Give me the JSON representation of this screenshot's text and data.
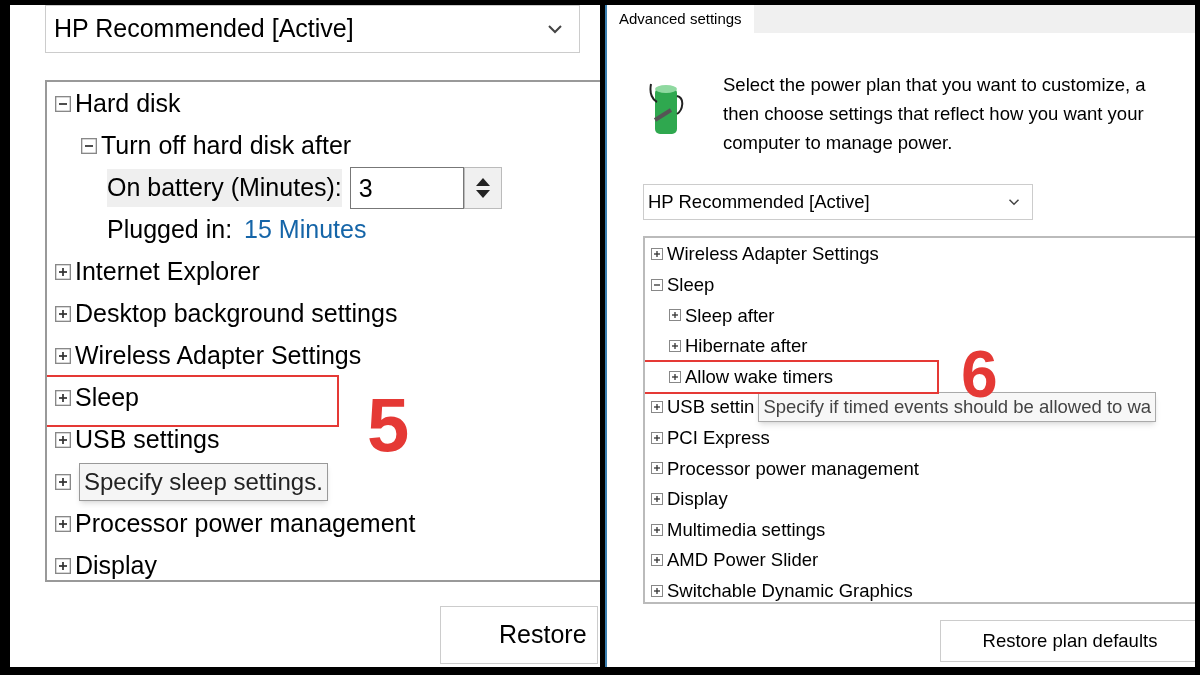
{
  "left_panel": {
    "plan_dropdown": {
      "value": "HP Recommended [Active]"
    },
    "tree": [
      {
        "kind": "group",
        "label": "Hard disk",
        "expanded": true,
        "children": [
          {
            "kind": "group",
            "label": "Turn off hard disk after",
            "expanded": true,
            "children": [
              {
                "kind": "spin",
                "label": "On battery (Minutes):",
                "value": "3"
              },
              {
                "kind": "value",
                "label": "Plugged in:",
                "value": "15 Minutes"
              }
            ]
          }
        ]
      },
      {
        "kind": "group",
        "label": "Internet Explorer",
        "expanded": false
      },
      {
        "kind": "group",
        "label": "Desktop background settings",
        "expanded": false
      },
      {
        "kind": "group",
        "label": "Wireless Adapter Settings",
        "expanded": false
      },
      {
        "kind": "group",
        "label": "Sleep",
        "expanded": false,
        "highlighted": true,
        "step": "5"
      },
      {
        "kind": "group",
        "label": "USB settings",
        "expanded": false
      },
      {
        "kind": "tooltip",
        "tooltip": "Specify sleep settings.",
        "expanded": false
      },
      {
        "kind": "group",
        "label": "Processor power management",
        "expanded": false
      },
      {
        "kind": "group",
        "label": "Display",
        "expanded": false
      }
    ],
    "restore_button": "Restore"
  },
  "right_panel": {
    "tab": "Advanced settings",
    "description": [
      "Select the power plan that you want to customize, a",
      "then choose settings that reflect how you want your",
      "computer to manage power."
    ],
    "plan_dropdown": {
      "value": "HP Recommended [Active]"
    },
    "tree": [
      {
        "kind": "group",
        "label": "Wireless Adapter Settings",
        "expanded": false
      },
      {
        "kind": "group",
        "label": "Sleep",
        "expanded": true,
        "children": [
          {
            "kind": "group",
            "label": "Sleep after",
            "expanded": false
          },
          {
            "kind": "group",
            "label": "Hibernate after",
            "expanded": false
          },
          {
            "kind": "group",
            "label": "Allow wake timers",
            "expanded": false,
            "highlighted": true,
            "step": "6"
          }
        ]
      },
      {
        "kind": "group",
        "label": "USB settin",
        "expanded": false,
        "tooltip": "Specify if timed events should be allowed to wa"
      },
      {
        "kind": "group",
        "label": "PCI Express",
        "expanded": false
      },
      {
        "kind": "group",
        "label": "Processor power management",
        "expanded": false
      },
      {
        "kind": "group",
        "label": "Display",
        "expanded": false
      },
      {
        "kind": "group",
        "label": "Multimedia settings",
        "expanded": false
      },
      {
        "kind": "group",
        "label": "AMD Power Slider",
        "expanded": false
      },
      {
        "kind": "group",
        "label": "Switchable Dynamic Graphics",
        "expanded": false
      }
    ],
    "restore_button": "Restore plan defaults"
  }
}
